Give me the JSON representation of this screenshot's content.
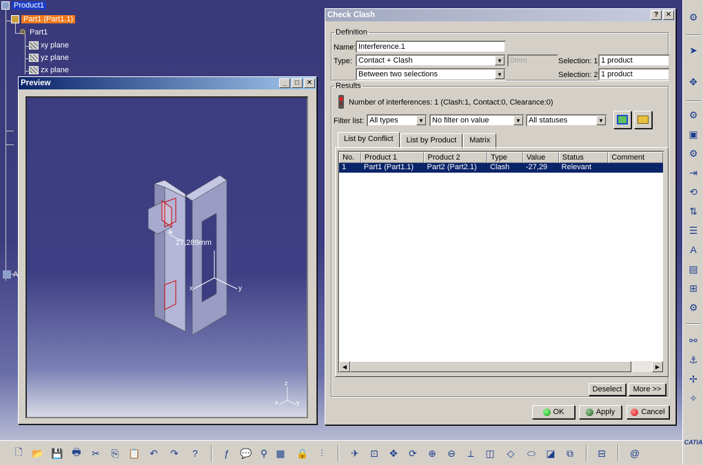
{
  "tree": {
    "root": "Product1",
    "part_instance": "Part1 (Part1.1)",
    "part": "Part1",
    "planes": [
      "xy plane",
      "yz plane",
      "zx plane"
    ],
    "partial_label": "Ap"
  },
  "preview": {
    "title": "Preview",
    "dimension": "27,289mm",
    "axis_x": "x",
    "axis_y": "y",
    "axis_z": "z"
  },
  "dialog": {
    "title": "Check Clash",
    "definition": {
      "legend": "Definition",
      "name_label": "Name:",
      "name_value": "Interference.1",
      "type_label": "Type:",
      "type_value": "Contact + Clash",
      "clearance_value": "0mm",
      "scope_value": "Between two selections",
      "selection1_label": "Selection: 1",
      "selection1_value": "1 product",
      "selection2_label": "Selection: 2",
      "selection2_value": "1 product"
    },
    "results": {
      "legend": "Results",
      "summary": "Number of interferences: 1 (Clash:1, Contact:0, Clearance:0)",
      "filter_label": "Filter list:",
      "filter_types": "All types",
      "filter_value": "No filter on value",
      "filter_status": "All statuses",
      "tabs": [
        "List by Conflict",
        "List by Product",
        "Matrix"
      ],
      "columns": [
        "No.",
        "Product 1",
        "Product 2",
        "Type",
        "Value",
        "Status",
        "Comment"
      ],
      "rows": [
        [
          "1",
          "Part1 (Part1.1)",
          "Part2 (Part2.1)",
          "Clash",
          "-27,29",
          "Relevant",
          ""
        ]
      ]
    },
    "buttons": {
      "deselect": "Deselect",
      "more": "More >>",
      "ok": "OK",
      "apply": "Apply",
      "cancel": "Cancel"
    },
    "help": "?",
    "close": "✕"
  },
  "colors": {
    "ok": "#1a9a1a",
    "apply": "#1a5a1a",
    "cancel": "#c81e1e",
    "selection": "#0a246a",
    "highlight": "#f07a1c"
  },
  "brand": {
    "name": "CATIA"
  }
}
